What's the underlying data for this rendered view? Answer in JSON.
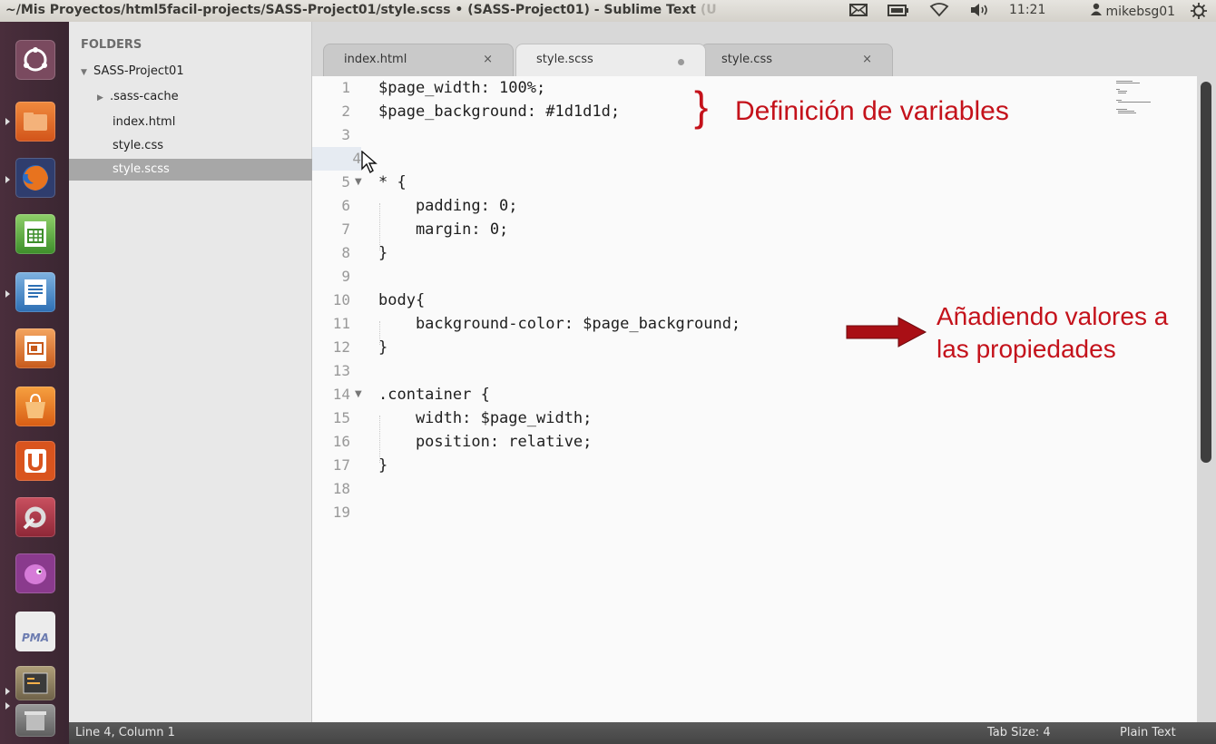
{
  "topbar": {
    "title": "~/Mis Proyectos/html5facil-projects/SASS-Project01/style.scss • (SASS-Project01) - Sublime Text",
    "title_fade": "(U",
    "time": "11:21",
    "user": "mikebsg01",
    "indicators": [
      "mail-icon",
      "battery-icon",
      "wifi-icon",
      "volume-icon",
      "power-icon"
    ]
  },
  "launcher": {
    "items": [
      "dash-icon",
      "files-icon",
      "firefox-icon",
      "calc-icon",
      "writer-icon",
      "impress-icon",
      "software-center-icon",
      "ubuntu-one-icon",
      "system-settings-icon",
      "pidgin-icon",
      "phpmyadmin-icon",
      "workspace-switcher-icon",
      "trash-icon"
    ],
    "pma_label": "PMA"
  },
  "sidebar": {
    "header": "FOLDERS",
    "project": "SASS-Project01",
    "items": [
      ".sass-cache",
      "index.html",
      "style.css",
      "style.scss"
    ]
  },
  "tabs": [
    {
      "label": "index.html",
      "close": "×"
    },
    {
      "label": "style.scss",
      "close": ""
    },
    {
      "label": "style.css",
      "close": "×"
    }
  ],
  "editor": {
    "line_numbers": [
      "1",
      "2",
      "3",
      "4",
      "5",
      "6",
      "7",
      "8",
      "9",
      "10",
      "11",
      "12",
      "13",
      "14",
      "15",
      "16",
      "17",
      "18",
      "19"
    ],
    "lines": [
      "$page_width: 100%;",
      "$page_background: #1d1d1d;",
      "",
      "",
      "* {",
      "    padding: 0;",
      "    margin: 0;",
      "}",
      "",
      "body{",
      "    background-color: $page_background;",
      "}",
      "",
      ".container {",
      "    width: $page_width;",
      "    position: relative;",
      "}",
      "",
      ""
    ],
    "current_line": 4
  },
  "annotations": {
    "brace": "}",
    "variables": "Definición de variables",
    "values_line1": "Añadiendo valores a",
    "values_line2": "las propiedades"
  },
  "status": {
    "position": "Line 4, Column 1",
    "tab_size": "Tab Size: 4",
    "syntax": "Plain Text"
  },
  "colors": {
    "annotation": "#c4121b",
    "arrow": "#a90f15"
  }
}
